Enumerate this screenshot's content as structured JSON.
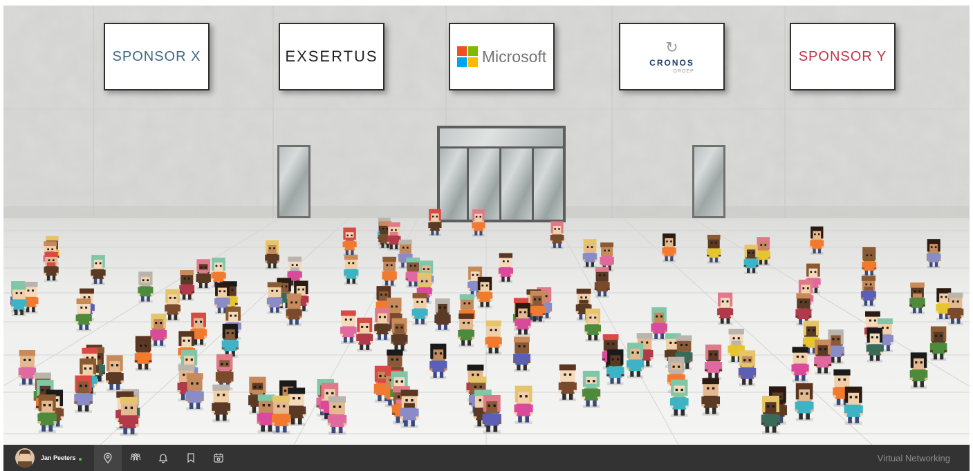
{
  "sponsors": [
    {
      "label": "SPONSOR X",
      "color": "#3b6a85"
    },
    {
      "label": "EXSERTUS",
      "color": "#222222",
      "accent": "#d0263a"
    },
    {
      "label": "Microsoft",
      "color": "#737373"
    },
    {
      "label": "CRONOS",
      "sub": "GROEP",
      "color": "#1a3d6b"
    },
    {
      "label": "SPONSOR Y",
      "color": "#c0334a"
    }
  ],
  "taskbar": {
    "user_name": "Jan Peeters",
    "status": "online",
    "icons": [
      {
        "name": "location-pin-icon",
        "active": true
      },
      {
        "name": "people-icon",
        "active": false
      },
      {
        "name": "bell-icon",
        "active": false
      },
      {
        "name": "bookmark-icon",
        "active": false
      },
      {
        "name": "calendar-icon",
        "active": false
      }
    ],
    "app_label": "Virtual Networking"
  },
  "colors": {
    "taskbar_bg": "#333333",
    "wall": "#d8d8d6",
    "floor": "#eeeeed",
    "online": "#6bbf3b",
    "ms_red": "#f25022",
    "ms_green": "#7fba00",
    "ms_blue": "#00a4ef",
    "ms_yellow": "#ffb900"
  }
}
